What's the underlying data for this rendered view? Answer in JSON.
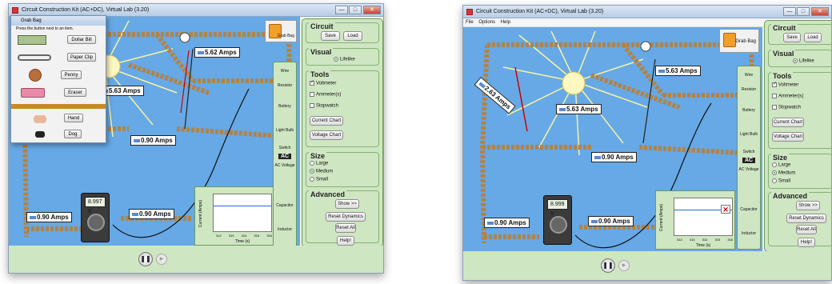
{
  "windows": [
    {
      "title": "Circuit Construction Kit (AC+DC), Virtual Lab (3.20)",
      "window_controls": [
        "—",
        "□",
        "✕"
      ],
      "menus": [],
      "grab_bag_label": "Grab Bag",
      "ammeters": [
        "5.62 Amps",
        "5.63 Amps",
        "0.90 Amps",
        "0.90 Amps",
        "0.90 Amps"
      ],
      "voltmeter_value": "8.997 V",
      "panel": {
        "circuit": {
          "title": "Circuit",
          "save": "Save",
          "load": "Load"
        },
        "visual": {
          "title": "Visual",
          "lifelike": "Lifelike"
        },
        "tools": {
          "title": "Tools",
          "voltmeter": "Voltmeter",
          "ammeter": "Ammeter(s)",
          "stopwatch": "Stopwatch",
          "current_chart": "Current Chart",
          "voltage_chart": "Voltage Chart"
        },
        "size": {
          "title": "Size",
          "large": "Large",
          "medium": "Medium",
          "small": "Small"
        },
        "advanced": {
          "title": "Advanced",
          "show": "Show >>",
          "reset_dynamics": "Reset Dynamics",
          "reset_all": "Reset All",
          "help": "Help!"
        }
      },
      "toolbox": [
        "Wire",
        "Resistor",
        "Battery",
        "Light Bulb",
        "Switch",
        "AC",
        "AC Voltage",
        "Capacitor",
        "Inductor"
      ],
      "chart": {
        "ylabel": "Current (Amps)",
        "xlabel": "Time (s)",
        "ticks": [
          "312",
          "313",
          "314",
          "315",
          "316"
        ]
      },
      "grab_bag_dialog": {
        "title": "Grab Bag",
        "instruction": "Press the button next to an item.",
        "items": [
          "Dollar Bill",
          "Paper Clip",
          "Penny",
          "Eraser",
          "Hand",
          "Dog"
        ]
      }
    },
    {
      "title": "Circuit Construction Kit (AC+DC), Virtual Lab (3.20)",
      "window_controls": [
        "—",
        "□",
        "✕"
      ],
      "menus": [
        "File",
        "Options",
        "Help"
      ],
      "grab_bag_label": "Grab Bag",
      "ammeters": [
        "5.63 Amps",
        "2.63 Amps",
        "5.63 Amps",
        "0.90 Amps",
        "0.90 Amps",
        "0.90 Amps"
      ],
      "voltmeter_value": "8.999 V",
      "panel": {
        "circuit": {
          "title": "Circuit",
          "save": "Save",
          "load": "Load"
        },
        "visual": {
          "title": "Visual",
          "lifelike": "Lifelike"
        },
        "tools": {
          "title": "Tools",
          "voltmeter": "Voltmeter",
          "ammeter": "Ammeter(s)",
          "stopwatch": "Stopwatch",
          "current_chart": "Current Chart",
          "voltage_chart": "Voltage Chart"
        },
        "size": {
          "title": "Size",
          "large": "Large",
          "medium": "Medium",
          "small": "Small"
        },
        "advanced": {
          "title": "Advanced",
          "show": "Show >>",
          "reset_dynamics": "Reset Dynamics",
          "reset_all": "Reset All",
          "help": "Help!"
        }
      },
      "toolbox": [
        "Wire",
        "Resistor",
        "Battery",
        "Light Bulb",
        "Switch",
        "AC",
        "AC Voltage",
        "Capacitor",
        "Inductor"
      ],
      "chart": {
        "ylabel": "Current (Amps)",
        "xlabel": "Time (s)",
        "ticks": [
          "312",
          "313",
          "314",
          "315",
          "316"
        ]
      }
    }
  ],
  "colors": {
    "canvas": "#66a9e6",
    "panel": "#cfe6c2",
    "wire": "#c89a52",
    "ammeter_bg": "#ffffff",
    "bulb_glow": "#fff4a8"
  }
}
